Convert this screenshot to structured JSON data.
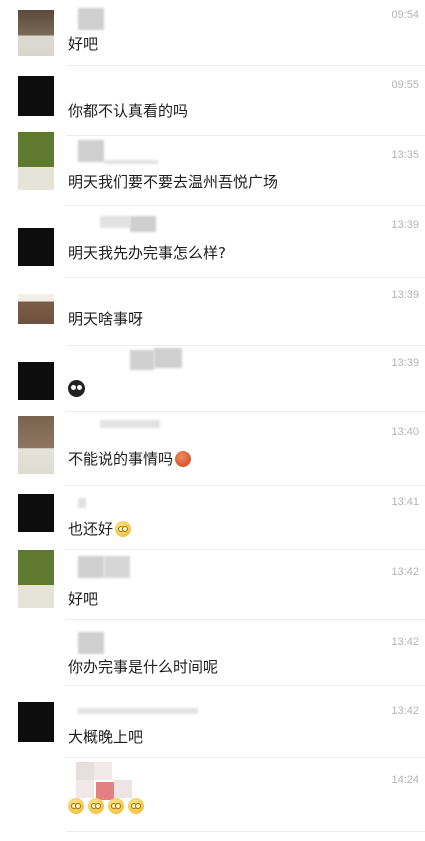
{
  "messages": [
    {
      "time": "09:54",
      "text": "好吧",
      "emoji": []
    },
    {
      "time": "09:55",
      "text": "你都不认真看的吗",
      "emoji": []
    },
    {
      "time": "13:35",
      "text": "明天我们要不要去温州吾悦广场",
      "emoji": []
    },
    {
      "time": "13:39",
      "text": "明天我先办完事怎么样?",
      "emoji": []
    },
    {
      "time": "13:39",
      "text": "明天啥事呀",
      "emoji": []
    },
    {
      "time": "13:39",
      "text": "",
      "emoji": [
        "owl-emoji"
      ]
    },
    {
      "time": "13:40",
      "text": "不能说的事情吗",
      "emoji": [
        "angry-emoji"
      ]
    },
    {
      "time": "13:41",
      "text": "也还好",
      "emoji": [
        "smile-emoji"
      ]
    },
    {
      "time": "13:42",
      "text": "好吧",
      "emoji": []
    },
    {
      "time": "13:42",
      "text": "你办完事是什么时间呢",
      "emoji": []
    },
    {
      "time": "13:42",
      "text": "大概晚上吧",
      "emoji": []
    },
    {
      "time": "14:24",
      "text": "",
      "emoji": [
        "smile-emoji",
        "smile-emoji",
        "smile-emoji",
        "smile-emoji"
      ]
    }
  ]
}
